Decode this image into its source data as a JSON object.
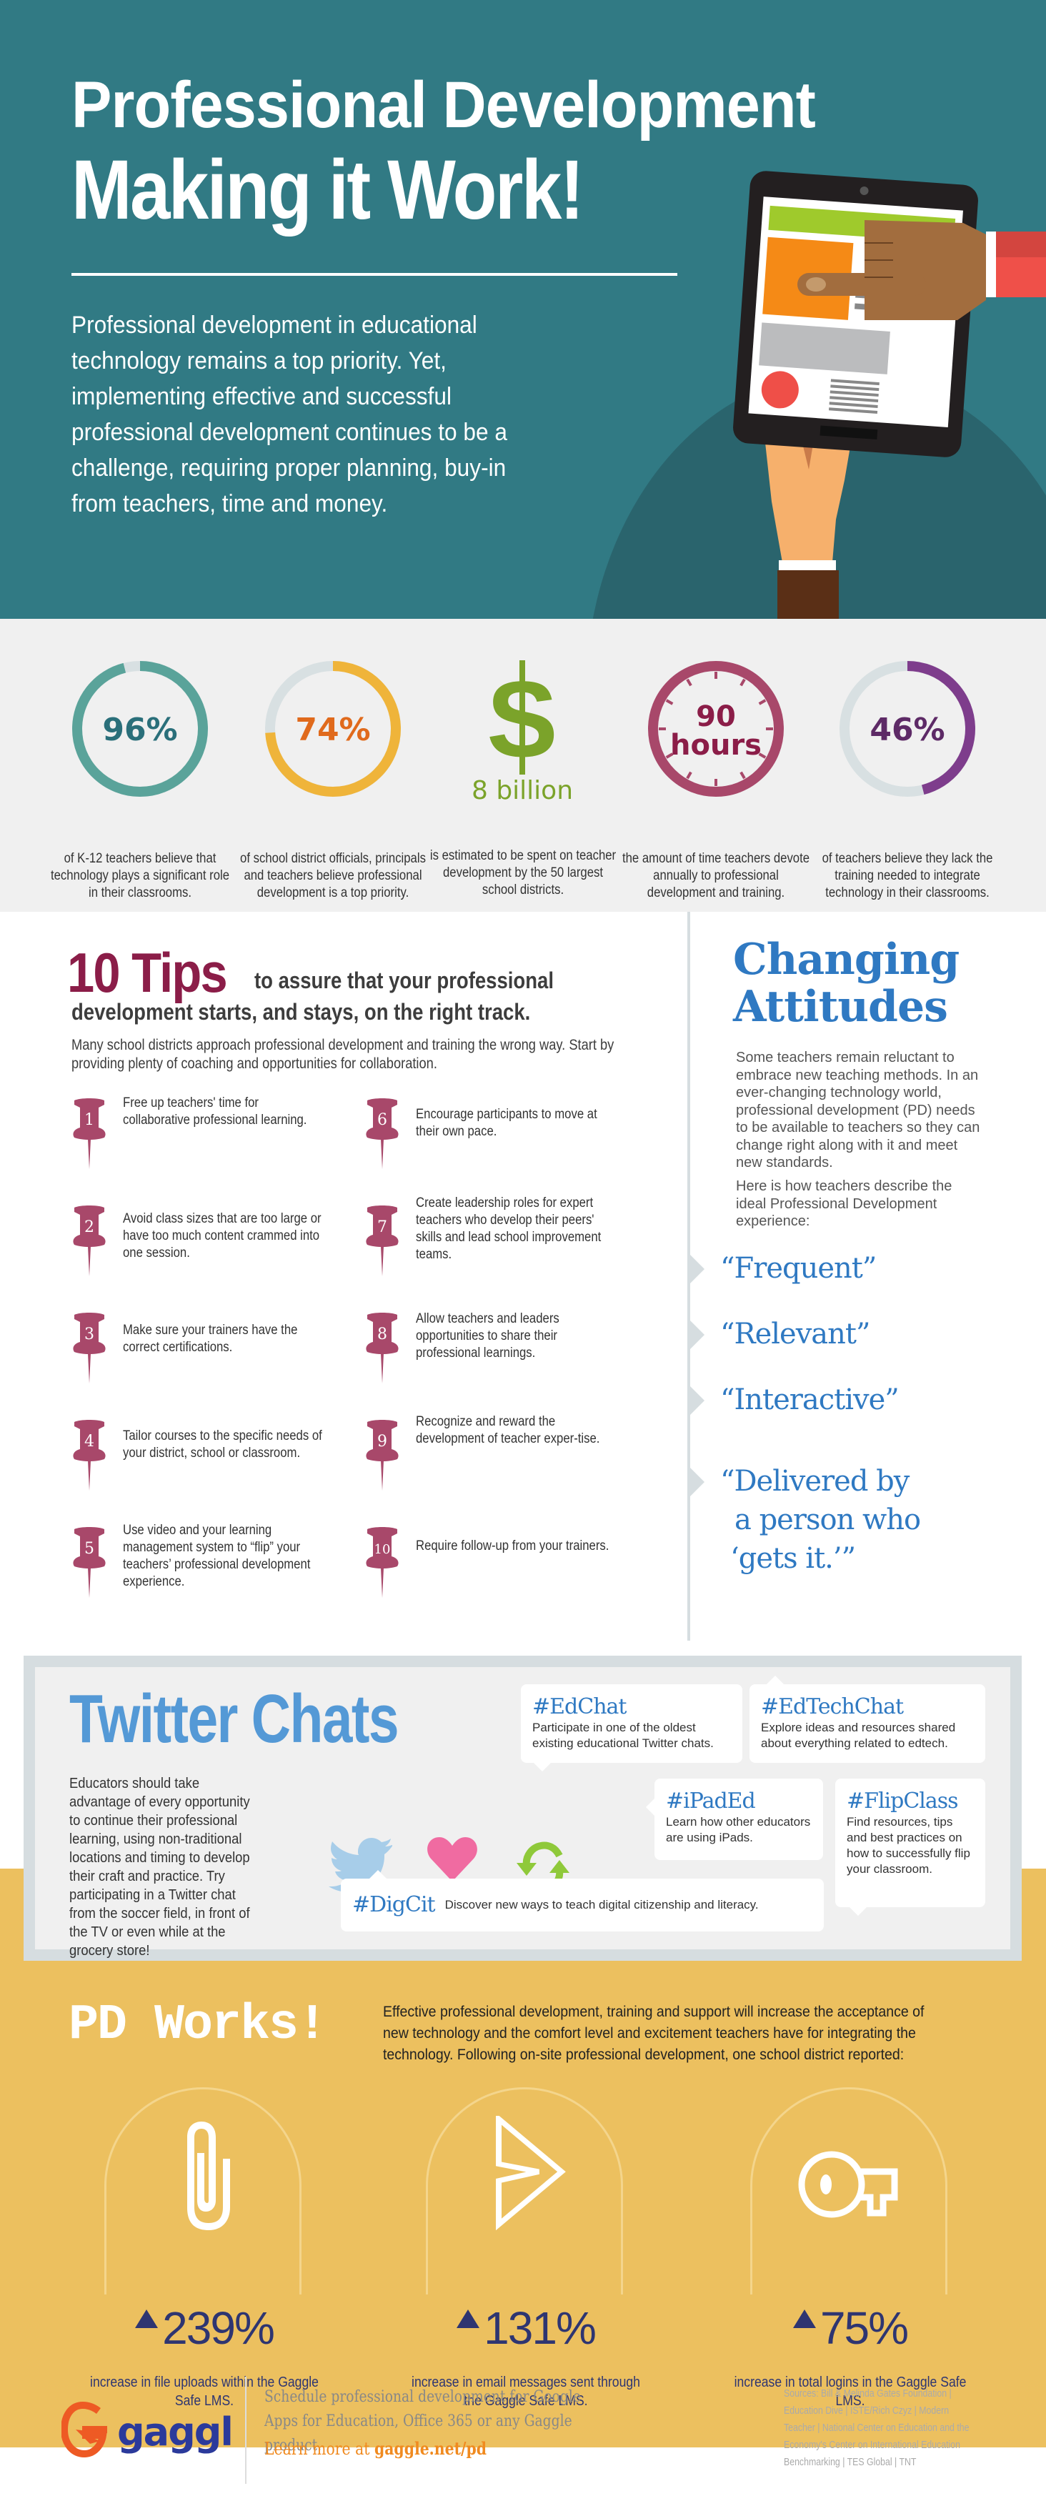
{
  "colors": {
    "header_bg": "#317a84",
    "header_shadow": "#2a646d",
    "stats_bg": "#f0f0f0",
    "tips_accent": "#8b1d48",
    "pin": "#a8486a",
    "attitudes_blue": "#2f79c2",
    "twitter_blue": "#5499d6",
    "yellow": "#ecc05f",
    "navy": "#2e3571",
    "gaggle_orange": "#ee5a24",
    "gaggle_navy": "#2b3a9b"
  },
  "hero": {
    "title_line1": "Professional Development",
    "title_line2": "Making it Work!",
    "intro": "Professional development in educational technology remains a top priority. Yet, implementing effective and successful professional development continues to be a challenge, requiring proper planning, buy-in from teachers, time and money."
  },
  "stats": [
    {
      "value": "96%",
      "percent": 96,
      "color": "#5aa39a",
      "text_color": "#2a6f7a",
      "description": "of K-12 teachers believe that technology plays a significant role in their classrooms."
    },
    {
      "value": "74%",
      "percent": 74,
      "color": "#efb43a",
      "text_color": "#e06a1c",
      "description": "of school district officials, principals and teachers believe professional development is a top priority."
    },
    {
      "value": "8 billion",
      "icon": "dollar-sign-icon",
      "color": "#7ba32a",
      "description": "is estimated to be spent on teacher development by the 50 largest school districts."
    },
    {
      "value_line1": "90",
      "value_line2": "hours",
      "icon": "clock-icon",
      "color": "#a8486a",
      "text_color": "#8b1d48",
      "description": "the amount of time teachers devote annually to professional development and training."
    },
    {
      "value": "46%",
      "percent": 46,
      "color": "#7e3d8c",
      "text_color": "#5d2a66",
      "description": "of teachers believe they lack the training needed to integrate technology in their classrooms."
    }
  ],
  "tips": {
    "heading_big": "10 Tips",
    "heading_line1": "to assure that your professional",
    "heading_line2": "development starts, and stays, on the right track.",
    "intro": "Many school districts approach professional development and training the wrong way. Start by providing plenty of coaching and opportunities for collaboration.",
    "items": [
      {
        "number": "1",
        "text": "Free up teachers' time for collaborative professional learning."
      },
      {
        "number": "2",
        "text": "Avoid class sizes that are too large or have too much content crammed into one session."
      },
      {
        "number": "3",
        "text": "Make sure your trainers have the correct certifications."
      },
      {
        "number": "4",
        "text": "Tailor courses to the specific needs of your district, school or classroom."
      },
      {
        "number": "5",
        "text": "Use video and your learning management system to “flip” your teachers’ professional development experience."
      },
      {
        "number": "6",
        "text": "Encourage participants to move at their own pace."
      },
      {
        "number": "7",
        "text": "Create leadership roles for expert teachers who develop their peers' skills and lead school improvement teams."
      },
      {
        "number": "8",
        "text": "Allow teachers and leaders opportunities to share their professional learnings."
      },
      {
        "number": "9",
        "text": "Recognize and reward the development of teacher exper-tise."
      },
      {
        "number": "10",
        "text": "Require follow-up from your trainers."
      }
    ]
  },
  "attitudes": {
    "title_line1": "Changing",
    "title_line2": "Attitudes",
    "body": "Some teachers remain reluctant to embrace new teaching methods. In an ever-changing technology world, professional development (PD) needs to be available to teachers so they can change right along with it and meet new standards.",
    "body2": "Here is how teachers describe the ideal Professional Development experience:",
    "quotes": [
      "“Frequent”",
      "“Relevant”",
      "“Interactive”",
      "“Delivered by",
      "a person who",
      "‘gets it.’”"
    ]
  },
  "twitter": {
    "title": "Twitter Chats",
    "body": "Educators should take advantage of every opportunity to continue their professional learning, using non-traditional locations and timing to develop their craft and practice. Try participating in a Twitter chat from the soccer field, in front of the TV or even while at the grocery store!",
    "chats": [
      {
        "tag": "#EdChat",
        "description": "Participate in one of the oldest existing educational Twitter chats."
      },
      {
        "tag": "#EdTechChat",
        "description": "Explore ideas and resources shared about everything related to edtech."
      },
      {
        "tag": "#iPadEd",
        "description": "Learn how other educators are using iPads."
      },
      {
        "tag": "#FlipClass",
        "description": "Find resources, tips and best practices on how to successfully flip your classroom."
      },
      {
        "tag": "#DigCit",
        "description": "Discover new ways to teach digital citizenship and literacy."
      }
    ],
    "icons": [
      "twitter-bird-icon",
      "heart-icon",
      "retweet-icon"
    ]
  },
  "pd_works": {
    "title": "PD Works!",
    "body": "Effective professional development, training and support will increase the acceptance of new technology and the comfort level and excitement teachers have for integrating the technology.  Following on-site professional development, one school district reported:",
    "stats": [
      {
        "icon": "paperclip-icon",
        "value": "239%",
        "caption": "increase in file uploads within the Gaggle Safe LMS."
      },
      {
        "icon": "send-icon",
        "value": "131%",
        "caption": "increase in email messages sent through the Gaggle Safe LMS."
      },
      {
        "icon": "key-icon",
        "value": "75%",
        "caption": "increase in total logins in the Gaggle Safe LMS."
      }
    ]
  },
  "footer": {
    "logo_text": "gaggle",
    "cta": "Schedule professional development for Google Apps for Education, Office 365 or any Gaggle product.",
    "learn_prefix": "Learn more at ",
    "learn_link": "gaggle.net/pd",
    "sources": "Sources: Bill & Melinda Gates Foundation | Education Dive | ISTE/Rich Czyz | Modern Teacher | National Center on Education and the Economy's Center on International Education Benchmarking | TES Global | TNT"
  }
}
